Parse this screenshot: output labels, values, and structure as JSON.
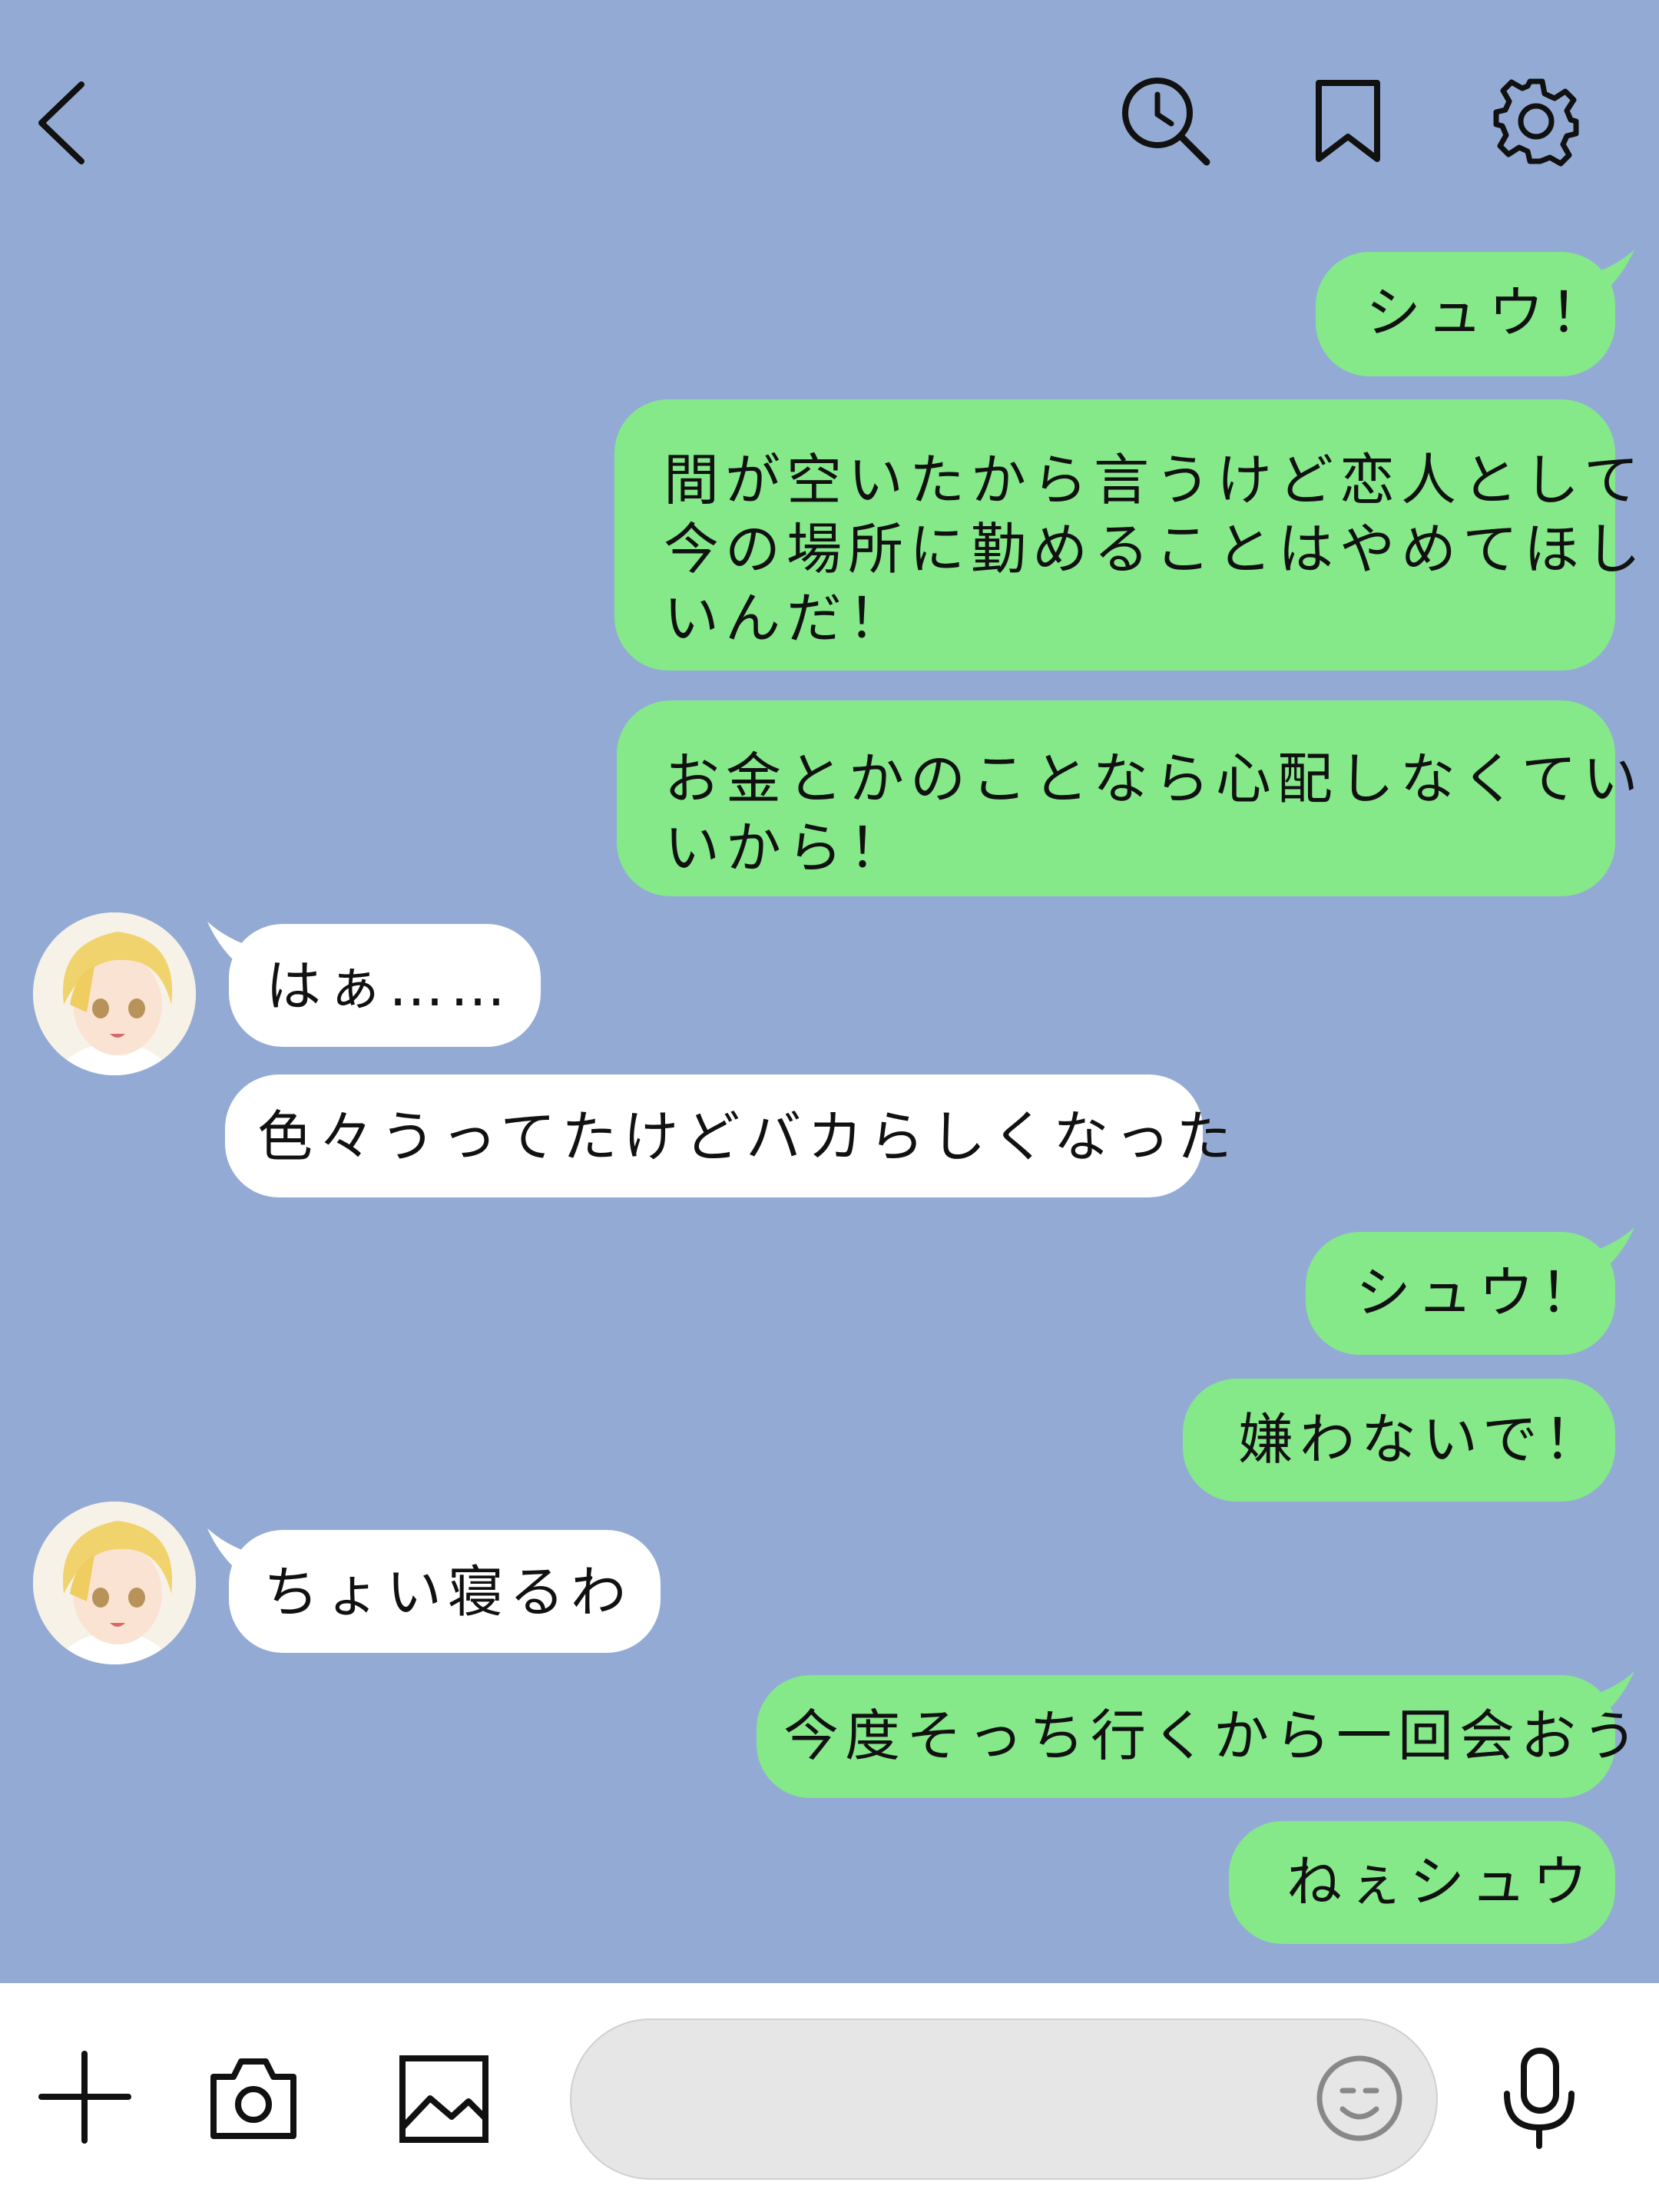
{
  "header": {
    "back_icon": "chevron-left-icon",
    "actions": [
      "search-history-icon",
      "bookmark-icon",
      "settings-gear-icon"
    ]
  },
  "messages": [
    {
      "side": "me",
      "text": "シュウ！"
    },
    {
      "side": "me",
      "lines": [
        "間が空いたから言うけど恋人として",
        "今の場所に勤めることはやめてほし",
        "いんだ！"
      ]
    },
    {
      "side": "me",
      "lines": [
        "お金とかのことなら心配しなくてい",
        "いから！"
      ]
    },
    {
      "side": "them",
      "text": "はぁ……"
    },
    {
      "side": "them",
      "text": "色々うってたけどバカらしくなった"
    },
    {
      "side": "me",
      "text": "シュウ！"
    },
    {
      "side": "me",
      "text": "嫌わないで！"
    },
    {
      "side": "them",
      "text": "ちょい寝るわ"
    },
    {
      "side": "me",
      "text": "今度そっち行くから一回会おう"
    },
    {
      "side": "me",
      "text": "ねぇシュウ"
    }
  ],
  "colors": {
    "background": "#93abd4",
    "my_bubble": "#85e98a",
    "their_bubble": "#ffffff",
    "input_bar": "#ffffff",
    "input_pill": "#e6e6e6"
  },
  "footer": {
    "icons": [
      "plus-icon",
      "camera-icon",
      "image-icon",
      "emoji-icon",
      "microphone-icon"
    ],
    "input_value": ""
  }
}
